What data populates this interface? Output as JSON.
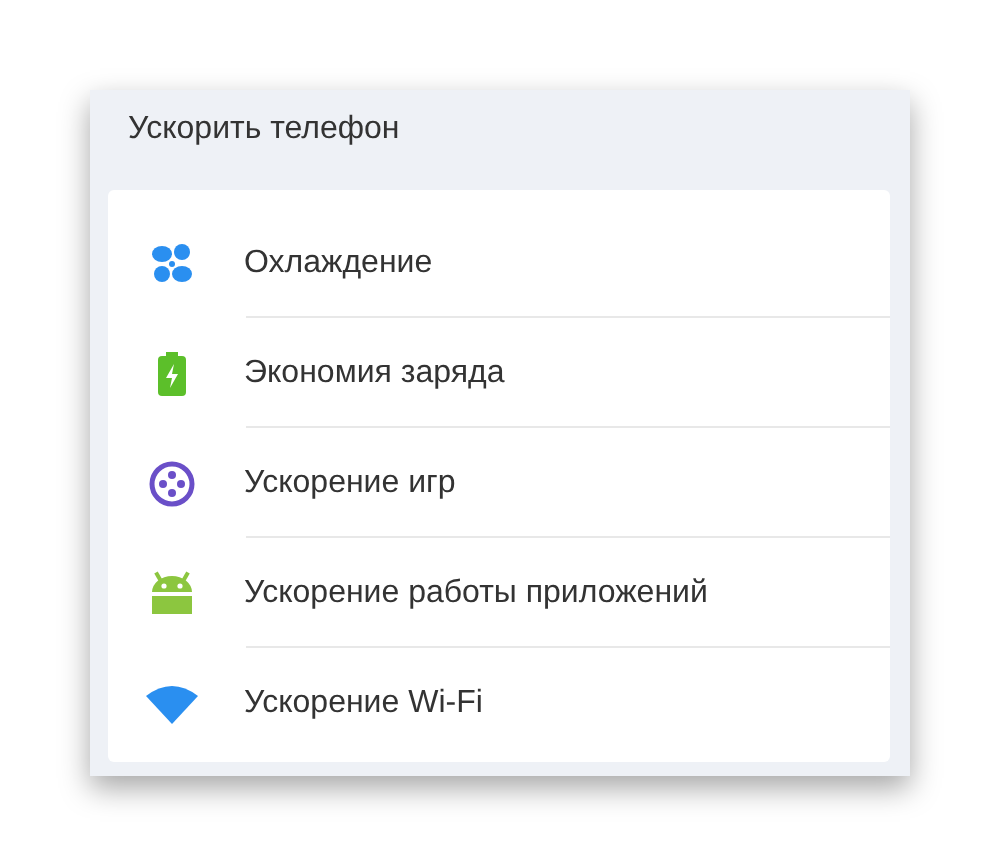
{
  "panel": {
    "title": "Ускорить телефон"
  },
  "items": [
    {
      "label": "Охлаждение"
    },
    {
      "label": "Экономия заряда"
    },
    {
      "label": "Ускорение игр"
    },
    {
      "label": "Ускорение работы приложений"
    },
    {
      "label": "Ускорение Wi-Fi"
    }
  ]
}
